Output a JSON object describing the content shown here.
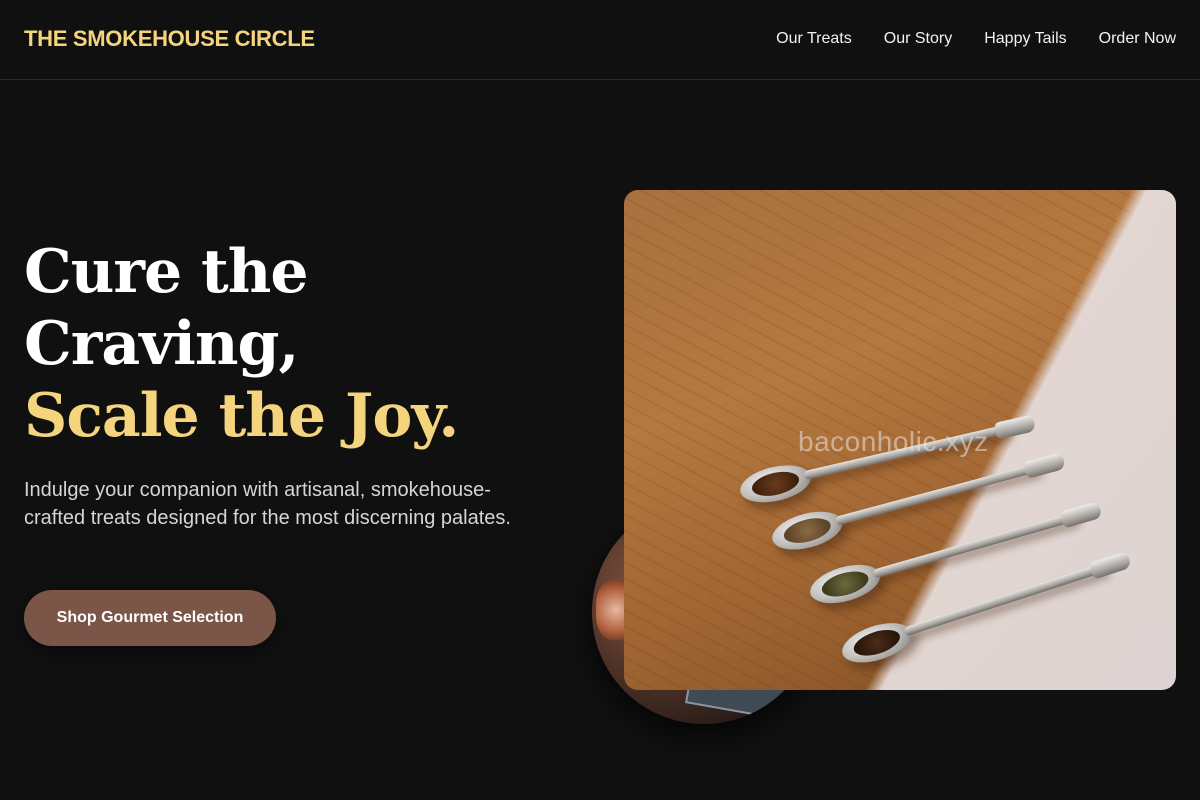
{
  "header": {
    "brand": "THE SMOKEHOUSE CIRCLE",
    "nav": [
      {
        "label": "Our Treats"
      },
      {
        "label": "Our Story"
      },
      {
        "label": "Happy Tails"
      },
      {
        "label": "Order Now"
      }
    ]
  },
  "hero": {
    "title_line1": "Cure the",
    "title_line2": "Craving,",
    "title_accent": "Scale the Joy.",
    "subtitle": "Indulge your companion with artisanal, smokehouse-crafted treats designed for the most discerning palates.",
    "cta_label": "Shop Gourmet Selection"
  },
  "media": {
    "watermark": "baconholic.xyz"
  },
  "colors": {
    "background": "#111011",
    "accent": "#f5d47e",
    "button": "#7a5548"
  }
}
